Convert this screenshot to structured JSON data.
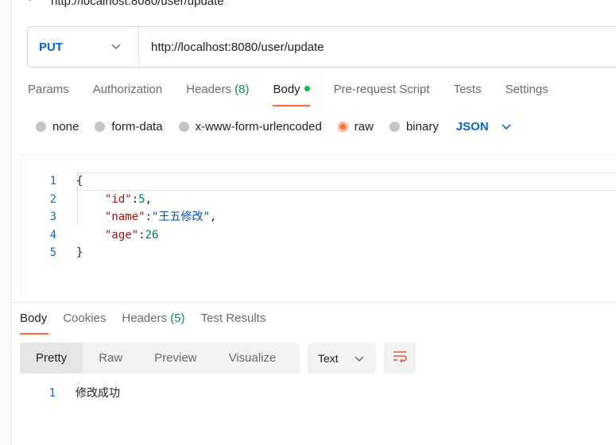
{
  "title": {
    "text": "http://localhost:8080/user/update"
  },
  "url_bar": {
    "method": "PUT",
    "url": "http://localhost:8080/user/update"
  },
  "request_tabs": [
    {
      "label": "Params"
    },
    {
      "label": "Authorization"
    },
    {
      "label": "Headers",
      "count": "(8)"
    },
    {
      "label": "Body"
    },
    {
      "label": "Pre-request Script"
    },
    {
      "label": "Tests"
    },
    {
      "label": "Settings"
    }
  ],
  "body_types": {
    "options": [
      "none",
      "form-data",
      "x-www-form-urlencoded",
      "raw",
      "binary"
    ],
    "selected": "raw",
    "format": "JSON"
  },
  "editor": {
    "lines": [
      {
        "num": "1",
        "text": "{"
      },
      {
        "num": "2",
        "key": "\"id\"",
        "sep": ":",
        "value": "5",
        "tail": ","
      },
      {
        "num": "3",
        "key": "\"name\"",
        "sep": ":",
        "value": "\"王五修改\"",
        "tail": ","
      },
      {
        "num": "4",
        "key": "\"age\"",
        "sep": ":",
        "value": "26",
        "tail": ""
      },
      {
        "num": "5",
        "text": "}"
      }
    ]
  },
  "response_tabs": [
    {
      "label": "Body"
    },
    {
      "label": "Cookies"
    },
    {
      "label": "Headers",
      "count": "(5)"
    },
    {
      "label": "Test Results"
    }
  ],
  "response_view": {
    "modes": [
      "Pretty",
      "Raw",
      "Preview",
      "Visualize"
    ],
    "selected": "Pretty",
    "format": "Text"
  },
  "response_body": {
    "lines": [
      {
        "num": "1",
        "text": "修改成功"
      }
    ]
  },
  "colors": {
    "accent": "#ff6c37",
    "method": "#0265d2",
    "count": "#0a8a52"
  }
}
